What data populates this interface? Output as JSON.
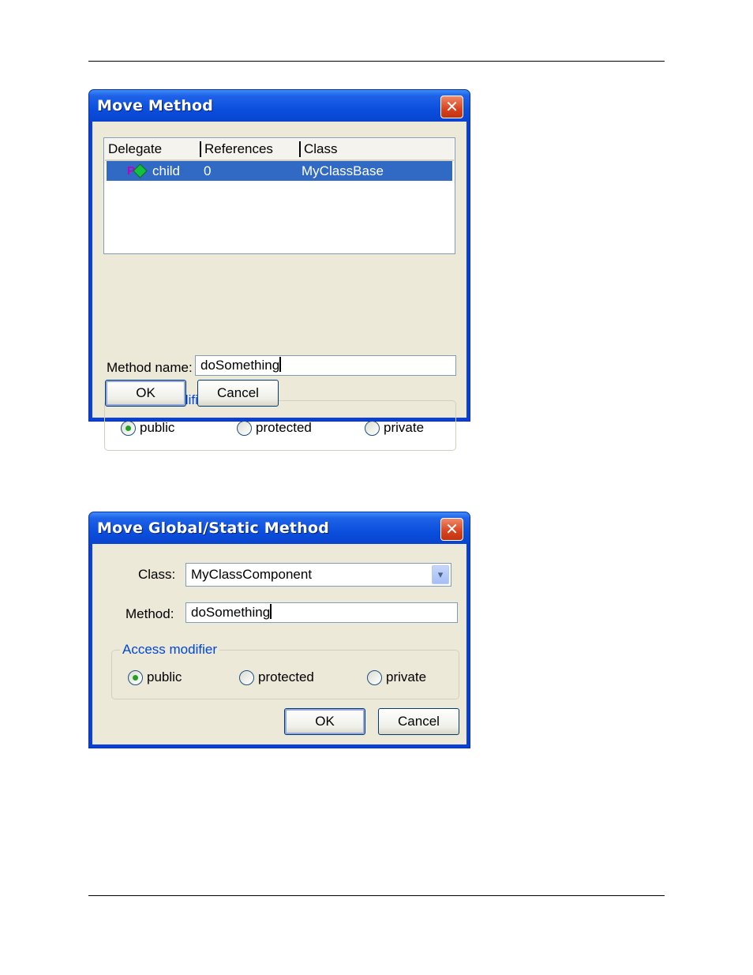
{
  "dialog1": {
    "title": "Move Method",
    "close_glyph": "✕",
    "list": {
      "columns": [
        "Delegate",
        "References",
        "Class"
      ],
      "rows": [
        {
          "delegate": "child",
          "references": "0",
          "class": "MyClassBase",
          "icon": "property-icon",
          "selected": true
        }
      ]
    },
    "method_name_label": "Method name:",
    "method_name_value": "doSomething",
    "access_modifier_label": "Access modifier",
    "radios": {
      "public": "public",
      "protected": "protected",
      "private": "private"
    },
    "selected_radio": "public",
    "ok_label": "OK",
    "cancel_label": "Cancel"
  },
  "dialog2": {
    "title": "Move Global/Static Method",
    "close_glyph": "✕",
    "class_label": "Class:",
    "class_value": "MyClassComponent",
    "method_label": "Method:",
    "method_value": "doSomething",
    "access_modifier_label": "Access modifier",
    "radios": {
      "public": "public",
      "protected": "protected",
      "private": "private"
    },
    "selected_radio": "public",
    "ok_label": "OK",
    "cancel_label": "Cancel",
    "combo_arrow_glyph": "▾"
  },
  "colors": {
    "titlebar": "#0b4fde",
    "selection": "#316ac5",
    "groupbox_label": "#0046d5",
    "dialog_face": "#ece9d8"
  }
}
